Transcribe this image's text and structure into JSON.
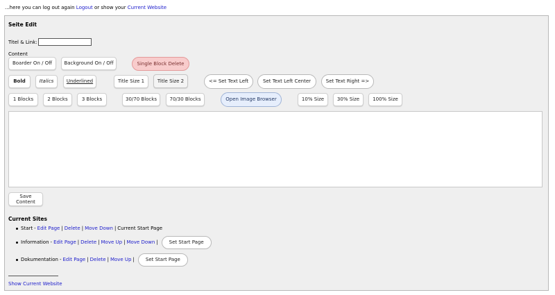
{
  "top": {
    "intro": "...here you can log out again",
    "logout": "Logout",
    "middle": "or show your",
    "current_website": "Current Website"
  },
  "editor": {
    "title": "Seite Edit",
    "titel_label": "Titel & Link:",
    "titel_value": "",
    "content_label": "Content",
    "buttons": {
      "boarder": "Boarder On / Off",
      "background": "Background On / Off",
      "single_block_delete": "Single Block Delete",
      "bold": "Bold",
      "italics": "Italics",
      "underlined": "Underlined",
      "title_size_1": "Title Size 1",
      "title_size_2": "Title Size 2",
      "text_left": "<= Set Text Left",
      "text_center": "Set Text Left Center",
      "text_right": "Set Text Right =>",
      "blocks_1": "1 Blocks",
      "blocks_2": "2 Blocks",
      "blocks_3": "3 Blocks",
      "blocks_30_70": "30/70 Blocks",
      "blocks_70_30": "70/30 Blocks",
      "image_browser": "Open Image Browser",
      "size_10": "10% Size",
      "size_30": "30% Size",
      "size_100": "100% Size"
    },
    "content_value": "",
    "save_line1": "Save",
    "save_line2": "Content"
  },
  "sites": {
    "heading": "Current Sites",
    "items": [
      {
        "name": "Start",
        "dash": "-",
        "edit": "Edit Page",
        "delete": "Delete",
        "move_down": "Move Down",
        "note": "Current Start Page"
      },
      {
        "name": "Information",
        "dash": "-",
        "edit": "Edit Page",
        "delete": "Delete",
        "move_up": "Move Up",
        "move_down": "Move Down",
        "set_start": "Set Start Page"
      },
      {
        "name": "Dokumentation",
        "dash": "-",
        "edit": "Edit Page",
        "delete": "Delete",
        "move_up": "Move Up",
        "set_start": "Set Start Page"
      }
    ],
    "separator": "|",
    "show_current": "Show Current Website"
  },
  "colors": {
    "link": "#2020cc",
    "panel_bg": "#efefef",
    "danger_bg": "#f8cccc",
    "info_bg": "#e6eefc"
  }
}
